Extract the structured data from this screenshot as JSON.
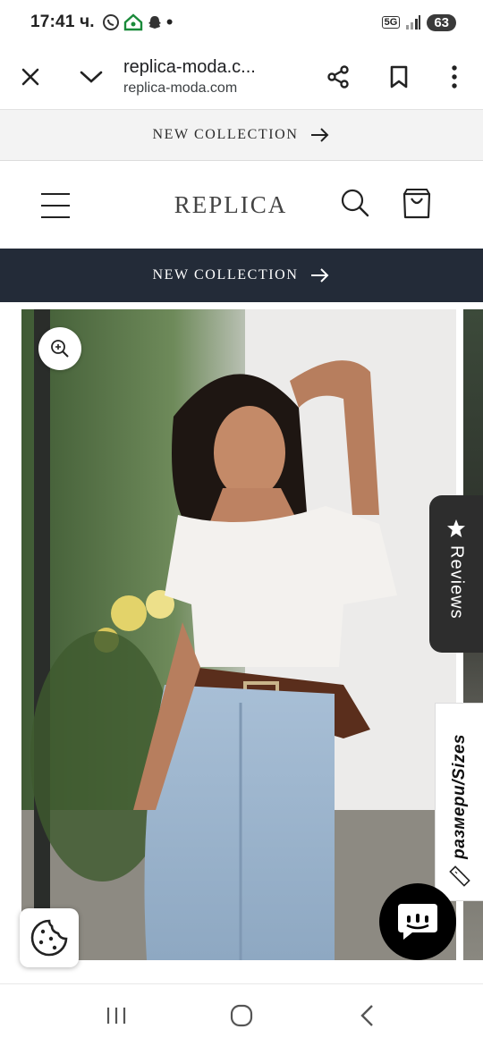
{
  "status_bar": {
    "time": "17:41 ч.",
    "network_label": "5G",
    "battery": "63"
  },
  "browser": {
    "page_title": "replica-moda.c...",
    "domain": "replica-moda.com"
  },
  "announcement_top": {
    "text": "NEW COLLECTION"
  },
  "header": {
    "logo": "REPLICA"
  },
  "announcement_dark": {
    "text": "NEW COLLECTION"
  },
  "widgets": {
    "reviews_label": "Reviews",
    "sizes_label": "размери/Sizes"
  },
  "colors": {
    "dark_bar": "#232b38",
    "reviews_tab": "#2d2d2d",
    "chat_button": "#000000"
  },
  "icons": [
    "close-icon",
    "chevron-down-icon",
    "share-icon",
    "bookmark-icon",
    "more-vert-icon",
    "menu-icon",
    "search-icon",
    "bag-icon",
    "zoom-in-icon",
    "star-icon",
    "ruler-icon",
    "chat-icon",
    "cookie-icon",
    "recents-icon",
    "home-icon",
    "back-icon"
  ]
}
